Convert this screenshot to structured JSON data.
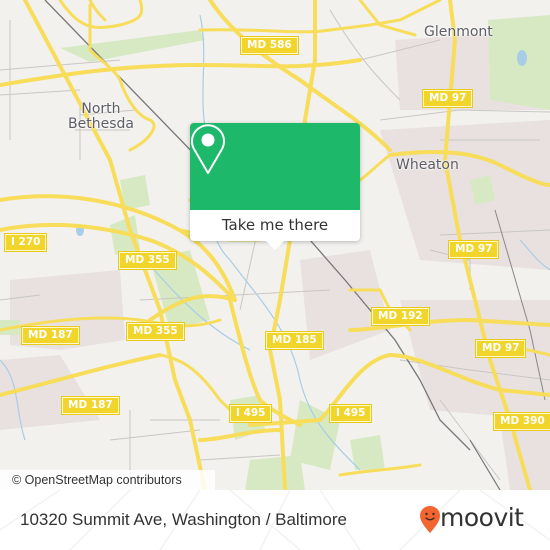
{
  "map": {
    "places": [
      {
        "name": "North Bethesda",
        "lines": [
          "North",
          "Bethesda"
        ]
      },
      {
        "name": "Glenmont",
        "lines": [
          "Glenmont"
        ]
      },
      {
        "name": "Wheaton",
        "lines": [
          "Wheaton"
        ]
      }
    ],
    "road_shields": [
      {
        "label": "MD 586"
      },
      {
        "label": "MD 97"
      },
      {
        "label": "I 270"
      },
      {
        "label": "MD 355"
      },
      {
        "label": "MD 97"
      },
      {
        "label": "MD 187"
      },
      {
        "label": "MD 355"
      },
      {
        "label": "MD 192"
      },
      {
        "label": "MD 185"
      },
      {
        "label": "MD 97"
      },
      {
        "label": "MD 187"
      },
      {
        "label": "I 495"
      },
      {
        "label": "I 495"
      },
      {
        "label": "MD 390"
      }
    ],
    "attribution": "© OpenStreetMap contributors",
    "colors": {
      "background": "#f2f1ee",
      "major_road": "#f7dd5a",
      "minor_road": "#c8c6c2",
      "park": "#d4e8bf",
      "water": "#a8cde6",
      "residential": "#e9e2e0",
      "rail": "#6e6e6e"
    }
  },
  "popup": {
    "icon": "location-pin-icon",
    "action_label": "Take me there",
    "accent_color": "#1eb86a"
  },
  "footer": {
    "address": "10320 Summit Ave, Washington / Baltimore",
    "brand": "moovit",
    "brand_color": "#f26430"
  }
}
